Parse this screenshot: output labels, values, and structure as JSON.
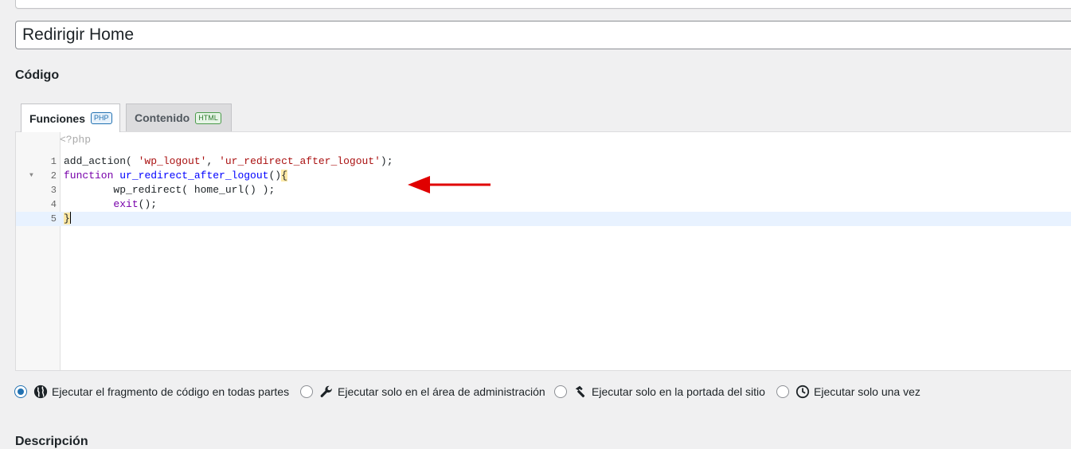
{
  "snippet": {
    "title": "Redirigir Home"
  },
  "code_section": {
    "heading": "Código",
    "tabs": [
      {
        "label": "Funciones",
        "badge": "PHP",
        "active": true
      },
      {
        "label": "Contenido",
        "badge": "HTML",
        "active": false
      }
    ],
    "open_tag": "<?php",
    "lines": [
      {
        "number": "1",
        "parts": [
          "add_action( ",
          "'wp_logout'",
          ", ",
          "'ur_redirect_after_logout'",
          ");"
        ]
      },
      {
        "number": "2",
        "parts": [
          "function",
          " ",
          "ur_redirect_after_logout",
          "()",
          "{"
        ]
      },
      {
        "number": "3",
        "parts": [
          "        wp_redirect( home_url() );"
        ]
      },
      {
        "number": "4",
        "parts": [
          "        ",
          "exit",
          "();"
        ]
      },
      {
        "number": "5",
        "parts": [
          "}"
        ]
      }
    ]
  },
  "run_scope": {
    "options": [
      {
        "label": "Ejecutar el fragmento de código en todas partes",
        "icon": "globe-icon",
        "checked": true
      },
      {
        "label": "Ejecutar solo en el área de administración",
        "icon": "wrench-icon",
        "checked": false
      },
      {
        "label": "Ejecutar solo en la portada del sitio",
        "icon": "hammer-icon",
        "checked": false
      },
      {
        "label": "Ejecutar solo una vez",
        "icon": "clock-icon",
        "checked": false
      }
    ]
  },
  "description": {
    "heading": "Descripción"
  },
  "colors": {
    "accent": "#2271b1",
    "annotation_arrow": "#e00000"
  }
}
